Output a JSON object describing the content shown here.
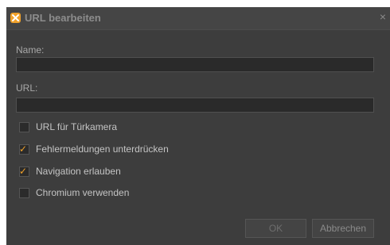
{
  "window": {
    "title": "URL bearbeiten",
    "close_glyph": "×",
    "icon": "app-logo-icon"
  },
  "form": {
    "name_label": "Name:",
    "name_value": "",
    "url_label": "URL:",
    "url_value": ""
  },
  "options": [
    {
      "label": "URL für Türkamera",
      "checked": false
    },
    {
      "label": "Fehlermeldungen unterdrücken",
      "checked": true
    },
    {
      "label": "Navigation erlauben",
      "checked": true
    },
    {
      "label": "Chromium verwenden",
      "checked": false
    }
  ],
  "buttons": {
    "ok": "OK",
    "cancel": "Abbrechen"
  },
  "colors": {
    "dialog_bg": "#3d3d3d",
    "accent": "#f0a12a"
  }
}
